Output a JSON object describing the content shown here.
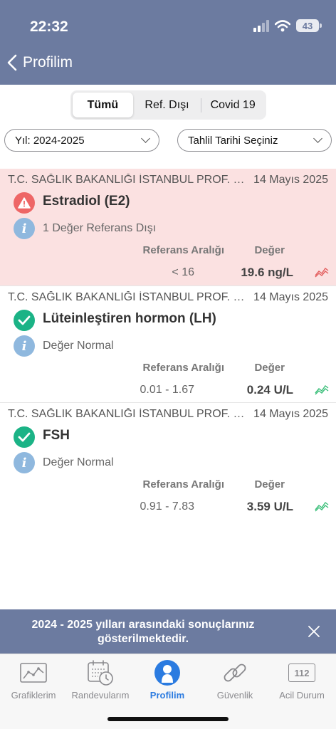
{
  "status_bar": {
    "time": "22:32",
    "battery": "43"
  },
  "nav": {
    "back_title": "Profilim"
  },
  "segments": [
    {
      "label": "Tümü",
      "active": true
    },
    {
      "label": "Ref. Dışı",
      "active": false
    },
    {
      "label": "Covid 19",
      "active": false
    }
  ],
  "filters": {
    "year": "Yıl: 2024-2025",
    "date": "Tahlil Tarihi Seçiniz"
  },
  "results": [
    {
      "hospital": "T.C. SAĞLIK BAKANLIĞI İSTANBUL PROF. D...",
      "date": "14 Mayıs 2025",
      "test": "Estradiol (E2)",
      "status": "warning",
      "info": "1 Değer Referans Dışı",
      "ref_header": "Referans Aralığı",
      "value_header": "Değer",
      "ref_range": "< 16",
      "value": "19.6 ng/L",
      "trend_color": "#e35d5d"
    },
    {
      "hospital": "T.C. SAĞLIK BAKANLIĞI İSTANBUL PROF. D...",
      "date": "14 Mayıs 2025",
      "test": "Lüteinleştiren hormon (LH)",
      "status": "normal",
      "info": "Değer Normal",
      "ref_header": "Referans Aralığı",
      "value_header": "Değer",
      "ref_range": "0.01 - 1.67",
      "value": "0.24 U/L",
      "trend_color": "#3bbf7a"
    },
    {
      "hospital": "T.C. SAĞLIK BAKANLIĞI İSTANBUL PROF. D...",
      "date": "14 Mayıs 2025",
      "test": "FSH",
      "status": "normal",
      "info": "Değer Normal",
      "ref_header": "Referans Aralığı",
      "value_header": "Değer",
      "ref_range": "0.91 - 7.83",
      "value": "3.59 U/L",
      "trend_color": "#3bbf7a"
    }
  ],
  "banner": {
    "text": "2024 - 2025 yılları arasındaki sonuçlarınız gösterilmektedir."
  },
  "tabs": [
    {
      "label": "Grafiklerim",
      "icon": "chart-icon",
      "active": false
    },
    {
      "label": "Randevularım",
      "icon": "calendar-clock-icon",
      "active": false
    },
    {
      "label": "Profilim",
      "icon": "person-icon",
      "active": true
    },
    {
      "label": "Güvenlik",
      "icon": "link-icon",
      "active": false
    },
    {
      "label": "Acil Durum",
      "icon": "emergency-112-icon",
      "badge": "112",
      "active": false
    }
  ],
  "colors": {
    "header": "#6c7ba0",
    "alert_bg": "#fbe1e1",
    "ok": "#1bb386",
    "warn": "#ee6666",
    "tab_active": "#2b7be0"
  }
}
